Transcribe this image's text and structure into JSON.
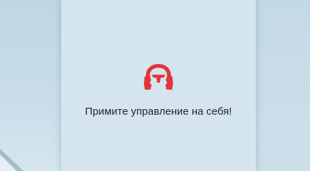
{
  "alert": {
    "icon": "hands-on-steering-wheel-icon",
    "icon_color": "#e2353a",
    "message": "Примите управление на себя!"
  },
  "colors": {
    "background": "#d5e5ef",
    "text": "#1d2226"
  }
}
